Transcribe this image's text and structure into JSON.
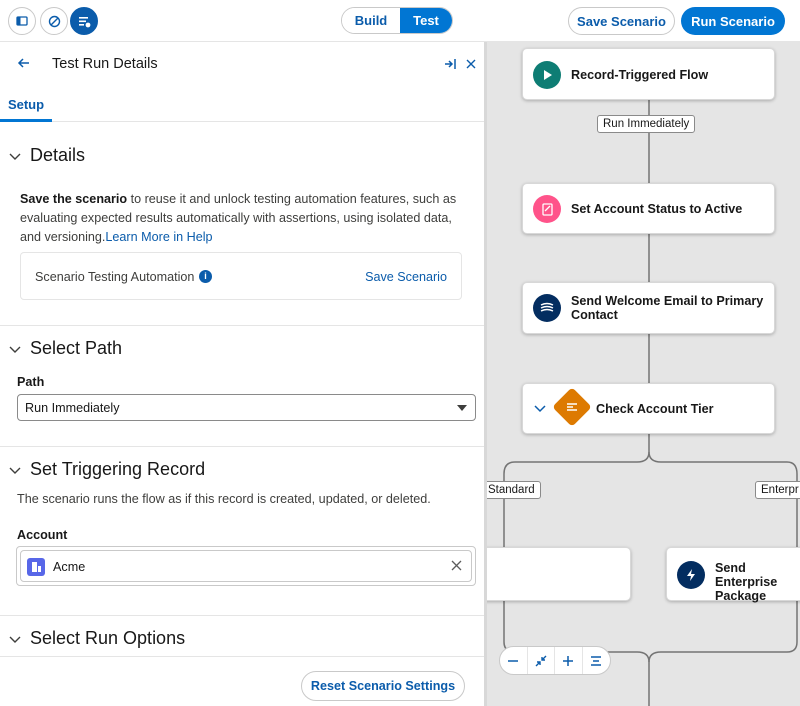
{
  "toolbar": {
    "icons": [
      "panel-toggle-icon",
      "disable-icon",
      "test-list-icon"
    ],
    "build_label": "Build",
    "test_label": "Test",
    "save_label": "Save Scenario",
    "run_label": "Run Scenario"
  },
  "panel": {
    "title": "Test Run Details",
    "tab": "Setup",
    "details": {
      "heading": "Details",
      "text_bold": "Save the scenario",
      "text_rest": " to reuse it and unlock testing automation features, such as evaluating expected results automatically with assertions, using isolated data, and versioning.",
      "link": "Learn More in Help",
      "card_label": "Scenario Testing Automation",
      "card_link": "Save Scenario"
    },
    "path": {
      "heading": "Select Path",
      "label": "Path",
      "value": "Run Immediately"
    },
    "trigger": {
      "heading": "Set Triggering Record",
      "description": "The scenario runs the flow as if this record is created, updated, or deleted.",
      "label": "Account",
      "value": "Acme"
    },
    "options": {
      "heading": "Select Run Options"
    },
    "reset_label": "Reset Scenario Settings"
  },
  "canvas": {
    "start_node": "Record-Triggered Flow",
    "path_pill": "Run Immediately",
    "node_update": "Set Account Status to Active",
    "node_email": "Send Welcome Email to Primary Contact",
    "node_decision": "Check Account Tier",
    "branch_left": "Standard",
    "branch_right": "Enterpr",
    "node_enterprise": "Send Enterprise Package"
  },
  "colors": {
    "brand": "#0176d3",
    "start_icon": "#0e7d74",
    "update_icon": "#ff538a",
    "email_icon": "#032d60",
    "decision_icon": "#dd7a01"
  }
}
